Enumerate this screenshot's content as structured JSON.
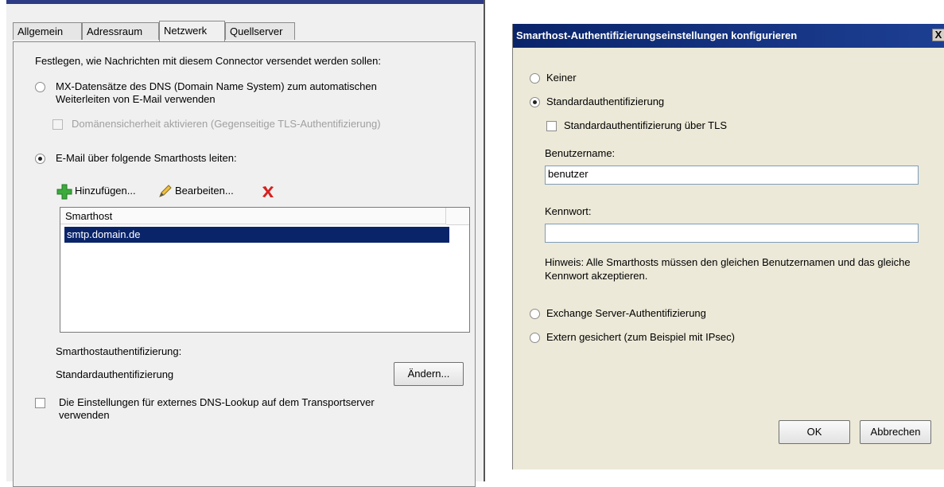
{
  "left": {
    "tabs": [
      "Allgemein",
      "Adressraum",
      "Netzwerk",
      "Quellserver"
    ],
    "active_tab": "Netzwerk",
    "intro": "Festlegen, wie Nachrichten mit diesem Connector versendet werden sollen:",
    "option_mx_line1": "MX-Datensätze des DNS (Domain Name System) zum automatischen",
    "option_mx_line2": "Weiterleiten von E-Mail verwenden",
    "domain_security": "Domänensicherheit aktivieren (Gegenseitige TLS-Authentifizierung)",
    "option_smarthost": "E-Mail über folgende Smarthosts leiten:",
    "toolbar": {
      "add": "Hinzufügen...",
      "edit": "Bearbeiten..."
    },
    "list": {
      "header": "Smarthost",
      "rows": [
        "smtp.domain.de"
      ]
    },
    "auth_label": "Smarthostauthentifizierung:",
    "auth_value": "Standardauthentifizierung",
    "change_button": "Ändern...",
    "dns_line1": "Die Einstellungen für externes DNS-Lookup auf dem Transportserver",
    "dns_line2": "verwenden"
  },
  "dialog": {
    "title": "Smarthost-Authentifizierungseinstellungen konfigurieren",
    "close": "X",
    "option_none": "Keiner",
    "option_basic": "Standardauthentifizierung",
    "basic_tls": "Standardauthentifizierung über TLS",
    "username_label": "Benutzername:",
    "username_value": "benutzer",
    "password_label": "Kennwort:",
    "password_value": "",
    "hint_line1": "Hinweis: Alle Smarthosts müssen den gleichen Benutzernamen und das gleiche",
    "hint_line2": "Kennwort akzeptieren.",
    "option_exchange": "Exchange Server-Authentifizierung",
    "option_external": "Extern gesichert (zum Beispiel mit IPsec)",
    "ok": "OK",
    "cancel": "Abbrechen"
  },
  "colors": {
    "selection": "#0a246a",
    "titlebar": "#0a246a",
    "add_icon": "#3cab3c",
    "delete_icon": "#d62020"
  }
}
